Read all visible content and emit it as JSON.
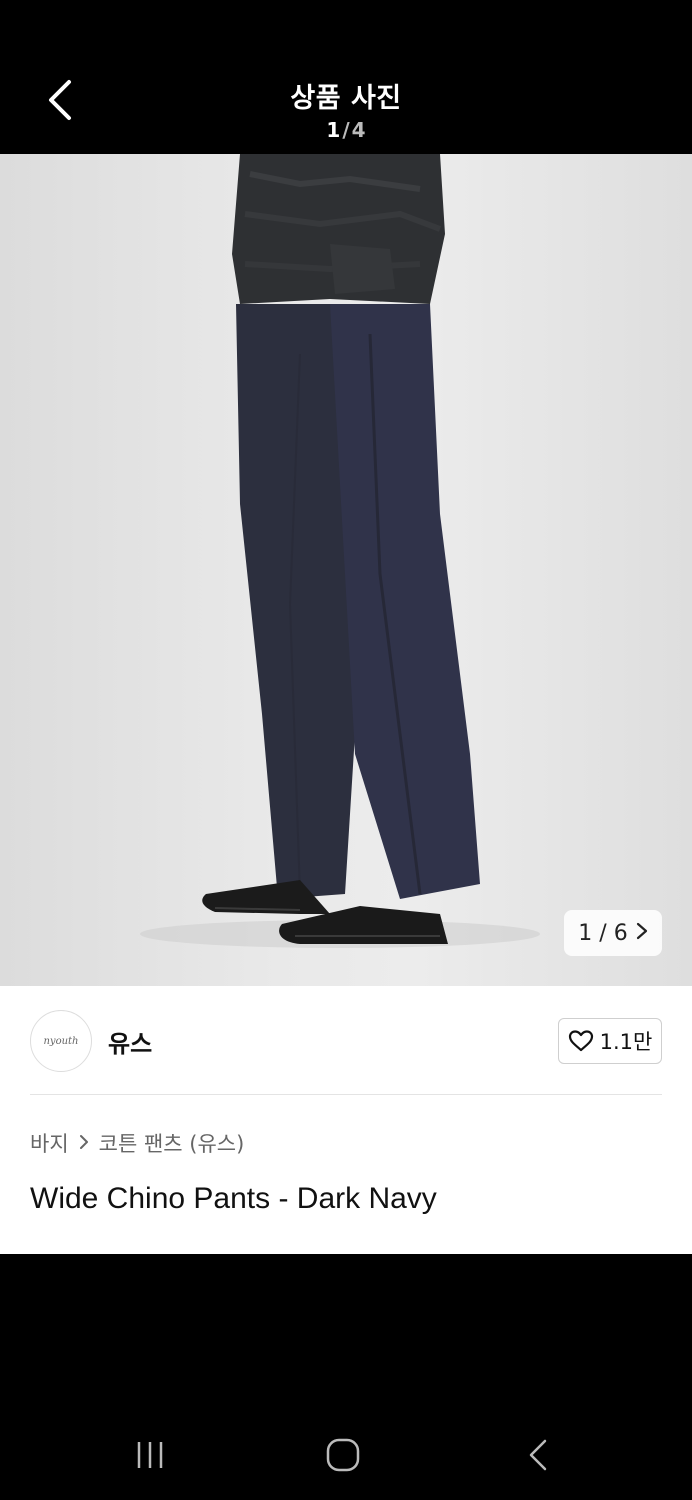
{
  "header": {
    "title": "상품 사진",
    "counter_current": "1",
    "counter_sep": "/",
    "counter_total": "4"
  },
  "photo": {
    "counter_text": "1 / 6",
    "next_icon": "chevron-right-icon"
  },
  "brand": {
    "name": "유스",
    "logo_text": "nyouth"
  },
  "like": {
    "count": "1.1만"
  },
  "breadcrumb": {
    "category": "바지",
    "subcategory": "코튼 팬츠 (유스)"
  },
  "product": {
    "name": "Wide Chino Pants - Dark Navy"
  },
  "colors": {
    "header_bg": "#000000",
    "pants": "#2c2f3e",
    "sweater": "#2e3033"
  }
}
